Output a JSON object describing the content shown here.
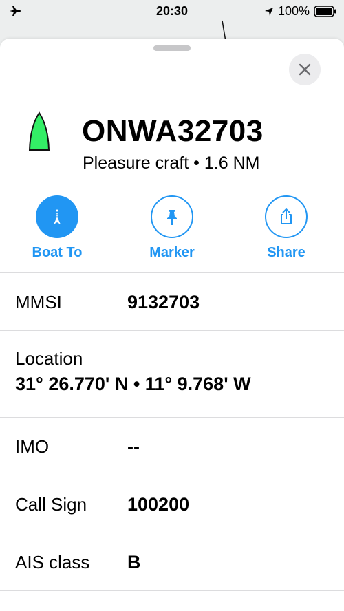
{
  "status_bar": {
    "time": "20:30",
    "battery_percent": "100%",
    "icons": [
      "airplane-icon",
      "location-arrow-icon",
      "battery-icon"
    ]
  },
  "vessel": {
    "name": "ONWA32703",
    "subtitle": "Pleasure craft • 1.6 NM",
    "icon": "vessel-icon",
    "icon_color": "#33ee66"
  },
  "actions": [
    {
      "label": "Boat To",
      "icon": "boat-to-icon"
    },
    {
      "label": "Marker",
      "icon": "pin-icon"
    },
    {
      "label": "Share",
      "icon": "share-icon"
    }
  ],
  "details": {
    "mmsi": {
      "label": "MMSI",
      "value": "9132703"
    },
    "location": {
      "label": "Location",
      "value": "31° 26.770' N • 11° 9.768' W"
    },
    "imo": {
      "label": "IMO",
      "value": "--"
    },
    "call_sign": {
      "label": "Call Sign",
      "value": "100200"
    },
    "ais_class": {
      "label": "AIS class",
      "value": "B"
    }
  },
  "colors": {
    "accent": "#2196f3",
    "vessel_fill": "#33ee66"
  }
}
